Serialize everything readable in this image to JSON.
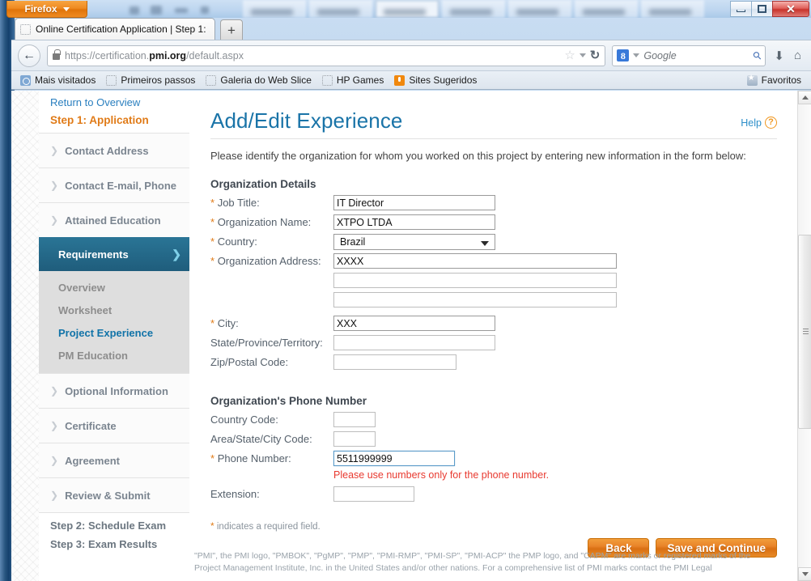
{
  "window": {
    "firefox_button": "Firefox",
    "controls": {
      "minimize": "minimize",
      "maximize": "maximize",
      "close": "close"
    }
  },
  "tabs": {
    "active_tab_title": "Online Certification Application | Step 1: ...",
    "new_tab_label": "+"
  },
  "navbar": {
    "url_prefix": "https://certification.",
    "url_domain": "pmi.org",
    "url_suffix": "/default.aspx",
    "search_engine": "Google",
    "search_placeholder": "Google"
  },
  "bookmarks": {
    "items": [
      {
        "label": "Mais visitados",
        "icon": "most-visited-icon"
      },
      {
        "label": "Primeiros passos",
        "icon": "placeholder-icon"
      },
      {
        "label": "Galeria do Web Slice",
        "icon": "placeholder-icon"
      },
      {
        "label": "HP Games",
        "icon": "placeholder-icon"
      },
      {
        "label": "Sites Sugeridos",
        "icon": "suggested-sites-icon"
      }
    ],
    "right_label": "Favoritos"
  },
  "sidebar": {
    "return_link": "Return to Overview",
    "step_label": "Step 1: Application",
    "items": [
      {
        "label": "Contact Address"
      },
      {
        "label": "Contact E-mail, Phone"
      },
      {
        "label": "Attained Education"
      }
    ],
    "active_item": "Requirements",
    "sub_items": [
      {
        "label": "Overview",
        "selected": false
      },
      {
        "label": "Worksheet",
        "selected": false
      },
      {
        "label": "Project Experience",
        "selected": true
      },
      {
        "label": "PM Education",
        "selected": false
      }
    ],
    "items_after": [
      {
        "label": "Optional Information"
      },
      {
        "label": "Certificate"
      },
      {
        "label": "Agreement"
      },
      {
        "label": "Review & Submit"
      }
    ],
    "steps": [
      "Step 2: Schedule Exam",
      "Step 3: Exam Results"
    ]
  },
  "main": {
    "title": "Add/Edit Experience",
    "help_label": "Help",
    "intro": "Please identify the organization for whom you worked on this project by entering new information in the form below:",
    "org_section_title": "Organization Details",
    "phone_section_title": "Organization's Phone Number",
    "fields": {
      "job_title": {
        "label": "Job Title:",
        "required": true,
        "value": "IT Director"
      },
      "organization_name": {
        "label": "Organization Name:",
        "required": true,
        "value": "XTPO LTDA"
      },
      "country": {
        "label": "Country:",
        "required": true,
        "value": "Brazil"
      },
      "organization_address": {
        "label": "Organization Address:",
        "required": true,
        "value": "XXXX"
      },
      "organization_address2": {
        "label": "",
        "required": false,
        "value": ""
      },
      "organization_address3": {
        "label": "",
        "required": false,
        "value": ""
      },
      "city": {
        "label": "City:",
        "required": true,
        "value": "XXX"
      },
      "state": {
        "label": "State/Province/Territory:",
        "required": false,
        "value": ""
      },
      "zip": {
        "label": "Zip/Postal Code:",
        "required": false,
        "value": ""
      },
      "country_code": {
        "label": "Country Code:",
        "required": false,
        "value": ""
      },
      "area_code": {
        "label": "Area/State/City Code:",
        "required": false,
        "value": ""
      },
      "phone_number": {
        "label": "Phone Number:",
        "required": true,
        "value": "5511999999",
        "focused": true
      },
      "extension": {
        "label": "Extension:",
        "required": false,
        "value": ""
      }
    },
    "error_message": "Please use numbers only for the phone number.",
    "required_note_star": "*",
    "required_note": " indicates a required field.",
    "buttons": {
      "back": "Back",
      "save_continue": "Save and Continue"
    }
  },
  "footer": {
    "line1": "\"PMI\", the PMI logo, \"PMBOK\", \"PgMP\", \"PMP\", \"PMI-RMP\", \"PMI-SP\", \"PMI-ACP\" the PMP logo, and \"CAPM\" are marks or registered marks of the",
    "line2": "Project Management Institute, Inc. in the United States and/or other nations. For a comprehensive list of PMI marks contact the PMI Legal"
  },
  "colors": {
    "accent_blue": "#1a74a8",
    "accent_orange": "#e07b18",
    "sidebar_active": "#22607f",
    "error_red": "#e8392f"
  }
}
